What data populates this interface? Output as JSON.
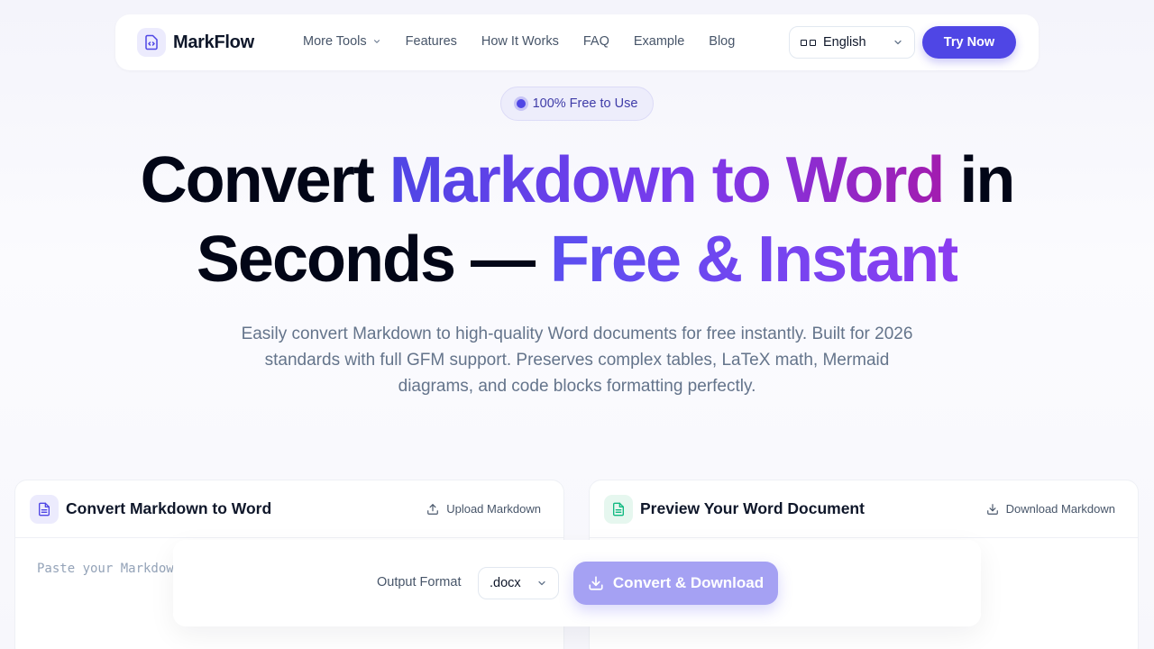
{
  "nav": {
    "brand": "MarkFlow",
    "links": [
      "More Tools",
      "Features",
      "How It Works",
      "FAQ",
      "Example",
      "Blog"
    ],
    "language": "English",
    "cta": "Try Now"
  },
  "badge": "100% Free to Use",
  "hero": {
    "part1": "Convert ",
    "highlight1": "Markdown to Word",
    "part2": " in",
    "part3": "Seconds — ",
    "highlight2": "Free & Instant"
  },
  "subtitle": "Easily convert Markdown to high-quality Word documents for free instantly. Built for 2026 standards with full GFM support. Preserves complex tables, LaTeX math, Mermaid diagrams, and code blocks formatting perfectly.",
  "left_panel": {
    "title": "Convert Markdown to Word",
    "action": "Upload Markdown",
    "placeholder": "Paste your Markdow"
  },
  "right_panel": {
    "title": "Preview Your Word Document",
    "action": "Download Markdown"
  },
  "bottom_bar": {
    "format_label": "Output Format",
    "format_value": ".docx",
    "convert_label": "Convert & Download"
  },
  "colors": {
    "accent": "#4f46e5",
    "gradient_end": "#a21caf"
  }
}
